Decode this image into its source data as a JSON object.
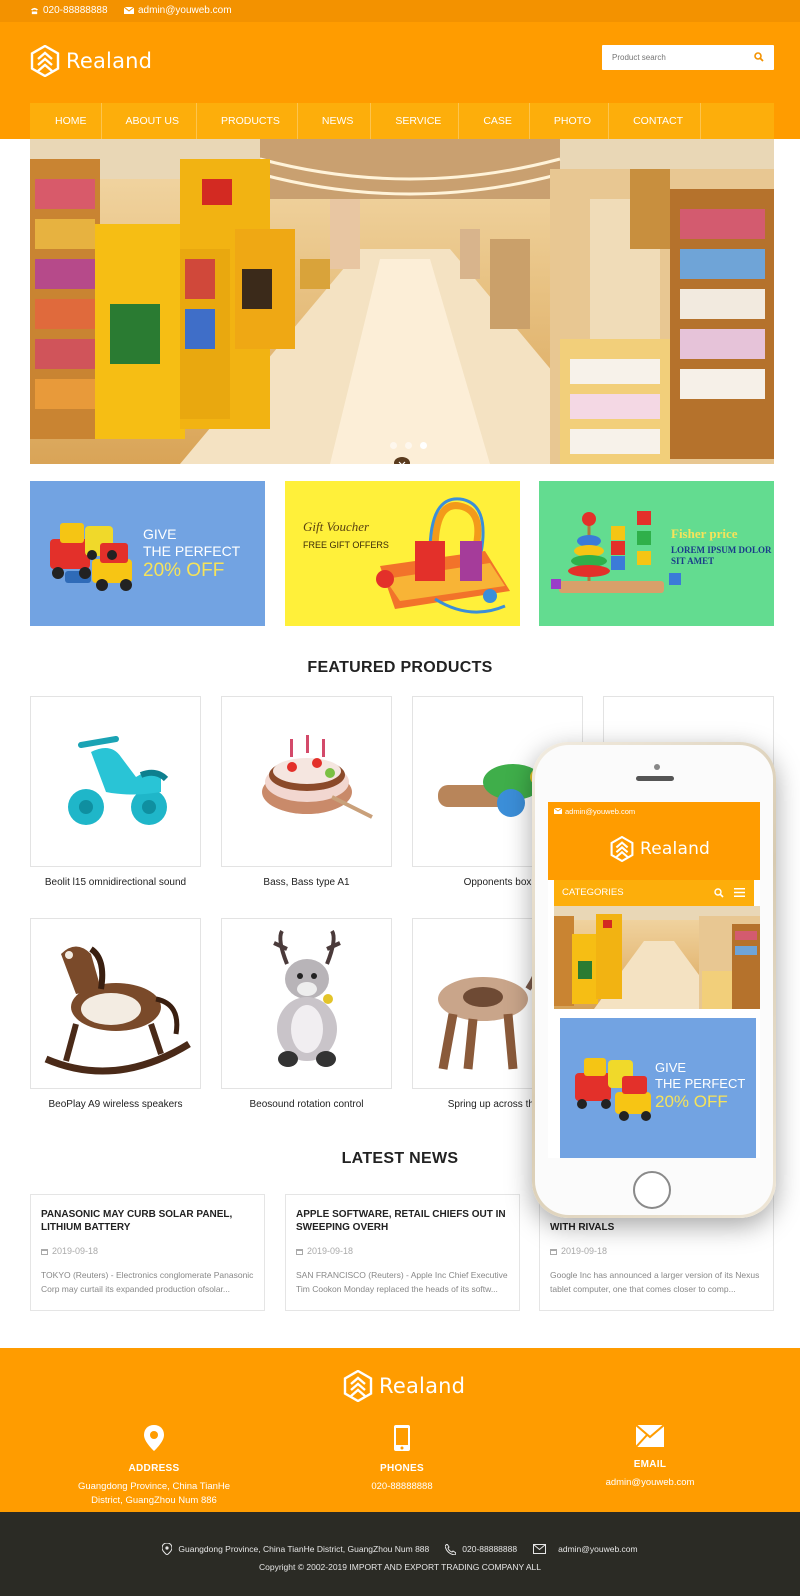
{
  "topbar": {
    "phone": "020-88888888",
    "email": "admin@youweb.com"
  },
  "brand": {
    "name": "Realand"
  },
  "search": {
    "placeholder": "Product search"
  },
  "nav": {
    "items": [
      "HOME",
      "ABOUT US",
      "PRODUCTS",
      "NEWS",
      "SERVICE",
      "CASE",
      "PHOTO",
      "CONTACT"
    ]
  },
  "promos": [
    {
      "line1": "GIVE",
      "line2a": "THE ",
      "line2b": "PERFECT",
      "line3": "20% OFF",
      "bg": "#72a3e2"
    },
    {
      "line1": "Gift Voucher",
      "line2": "FREE GIFT OFFERS",
      "bg": "#fff03a"
    },
    {
      "line1": "Fisher price",
      "line2": "LOREM IPSUM DOLOR",
      "line3": "SIT AMET",
      "bg": "#63dc90"
    }
  ],
  "featured": {
    "title": "FEATURED PRODUCTS",
    "products": [
      "Beolit l15 omnidirectional sound",
      "Bass, Bass type A1",
      "Opponents box",
      "",
      "BeoPlay A9 wireless speakers",
      "Beosound rotation control",
      "Spring up across the c",
      ""
    ]
  },
  "news": {
    "title": "LATEST NEWS",
    "items": [
      {
        "title": "PANASONIC MAY CURB SOLAR PANEL, LITHIUM BATTERY",
        "date": "2019-09-18",
        "excerpt": "TOKYO (Reuters) - Electronics conglomerate Panasonic Corp may curtail its expanded production ofsolar..."
      },
      {
        "title": "APPLE SOFTWARE, RETAIL CHIEFS OUT IN SWEEPING OVERH",
        "date": "2019-09-18",
        "excerpt": "SAN FRANCISCO (Reuters) - Apple Inc Chief Executive Tim Cookon Monday replaced the heads of its softw..."
      },
      {
        "title": "WITH RIVALS",
        "date": "2019-09-18",
        "excerpt": "Google Inc has announced a larger version of its Nexus tablet computer, one that comes closer to comp..."
      }
    ]
  },
  "footer": {
    "address_label": "ADDRESS",
    "address_value": "Guangdong Province, China TianHe District, GuangZhou Num 886",
    "phones_label": "PHONES",
    "phones_value": "020-88888888",
    "email_label": "EMAIL",
    "email_value": "admin@youweb.com",
    "bottom_address": "Guangdong Province, China TianHe District, GuangZhou Num 888",
    "bottom_phone": "020-88888888",
    "bottom_email": "admin@youweb.com",
    "copyright": "Copyright © 2002-2019 IMPORT AND EXPORT TRADING COMPANY  ALL"
  },
  "mobile": {
    "email": "admin@youweb.com",
    "categories_label": "CATEGORIES",
    "promo_line1": "GIVE",
    "promo_line2a": "THE ",
    "promo_line2b": "PERFECT",
    "promo_line3": "20% OFF"
  },
  "colors": {
    "brand_orange": "#ff9c00",
    "nav_orange": "#fdae0b",
    "footer_dark": "#2b2b25"
  }
}
